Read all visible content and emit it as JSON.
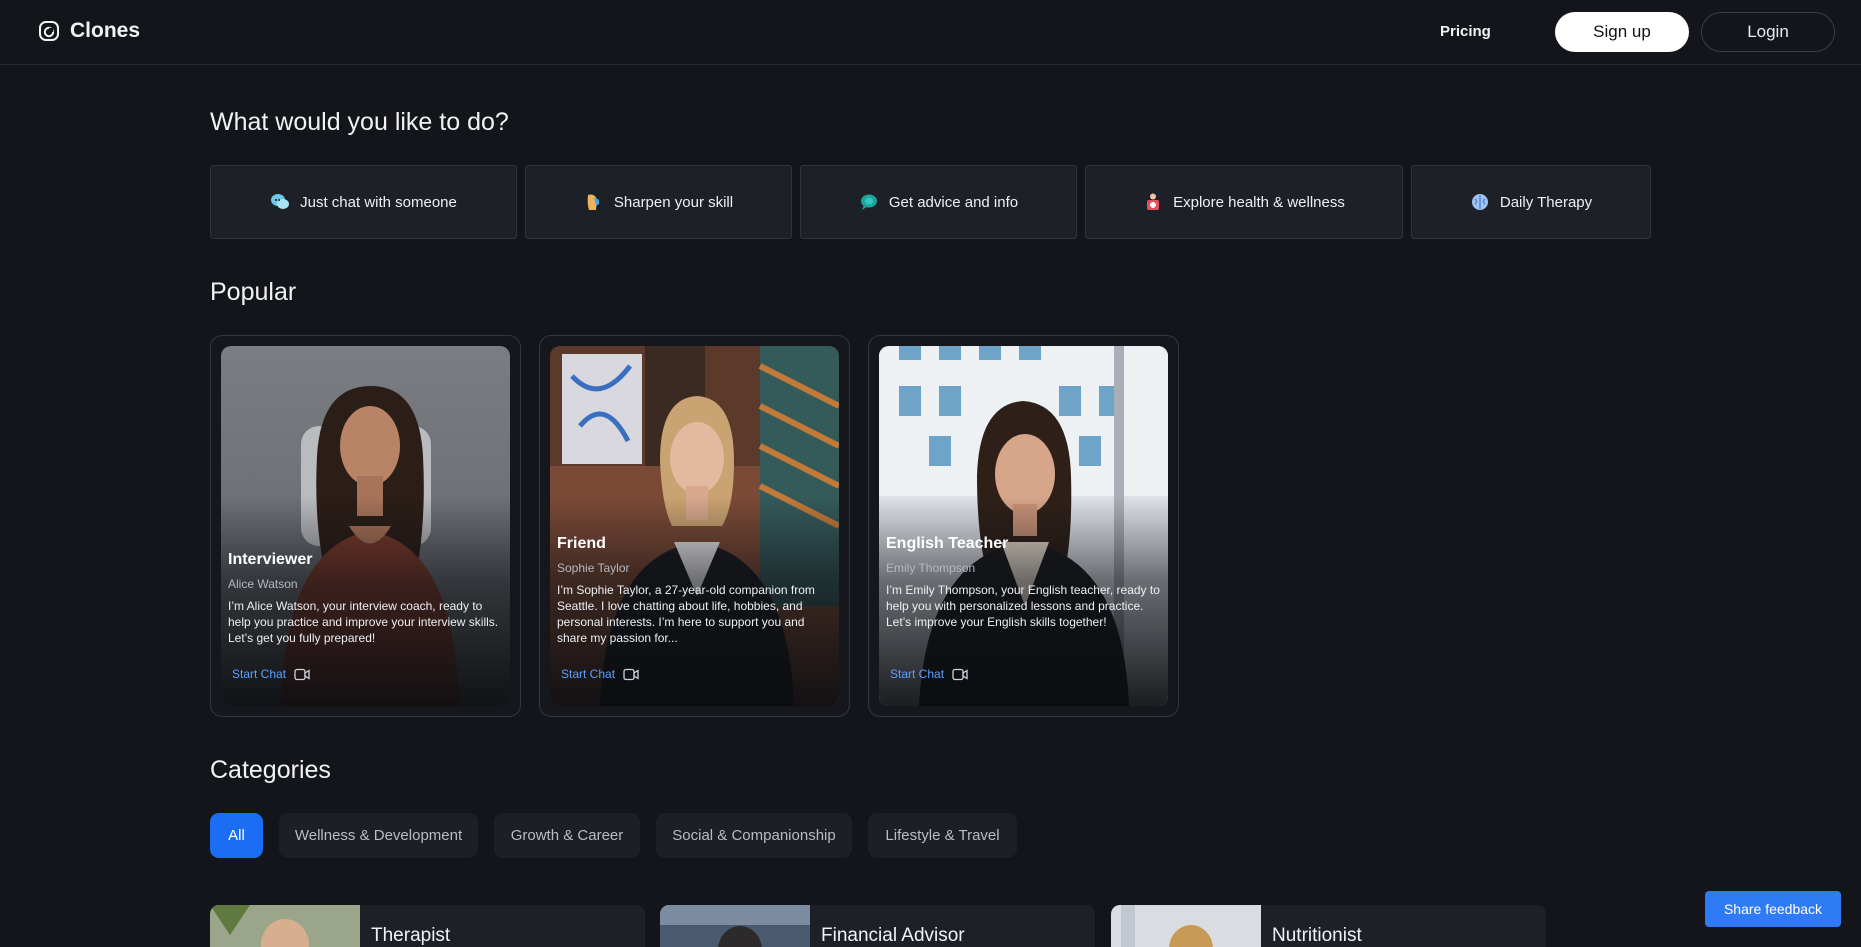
{
  "header": {
    "brand": "Clones",
    "nav_pricing": "Pricing",
    "signup": "Sign up",
    "login": "Login"
  },
  "intent_section": {
    "title": "What would you like to do?",
    "options": [
      {
        "label": "Just chat with someone",
        "icon": "chat-bubbles-icon"
      },
      {
        "label": "Sharpen your skill",
        "icon": "lightbulb-head-icon"
      },
      {
        "label": "Get advice and info",
        "icon": "speech-bubble-icon"
      },
      {
        "label": "Explore health & wellness",
        "icon": "health-kit-icon"
      },
      {
        "label": "Daily Therapy",
        "icon": "brain-icon"
      }
    ]
  },
  "popular": {
    "title": "Popular",
    "cards": [
      {
        "role": "Interviewer",
        "name": "Alice Watson",
        "description": "I’m Alice Watson, your interview coach, ready to help you practice and improve your interview skills. Let’s get you fully prepared!",
        "cta": "Start Chat"
      },
      {
        "role": "Friend",
        "name": "Sophie Taylor",
        "description": "I’m Sophie Taylor, a 27-year-old companion from Seattle. I love chatting about life, hobbies, and personal interests. I’m here to support you and share my passion for...",
        "cta": "Start Chat"
      },
      {
        "role": "English Teacher",
        "name": "Emily Thompson",
        "description": "I’m Emily Thompson, your English teacher, ready to help you with personalized lessons and practice. Let’s improve your English skills together!",
        "cta": "Start Chat"
      }
    ]
  },
  "categories": {
    "title": "Categories",
    "chips": [
      "All",
      "Wellness & Development",
      "Growth & Career",
      "Social & Companionship",
      "Lifestyle & Travel"
    ],
    "active": "All",
    "cards": [
      "Therapist",
      "Financial Advisor",
      "Nutritionist"
    ]
  },
  "feedback_button": "Share feedback",
  "colors": {
    "background": "#13151b",
    "accent": "#1b6ef3",
    "link": "#5aa0ff"
  }
}
